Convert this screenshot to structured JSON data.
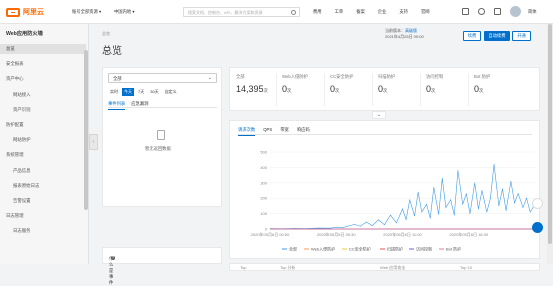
{
  "topbar": {
    "logo_text": "阿里云",
    "account_select": "账号全部资源",
    "region_select": "中国内地",
    "search_placeholder": "搜索文档、控制台、API、解决方案和资源",
    "nav": [
      "费用",
      "工单",
      "备案",
      "企业",
      "支持",
      "官网"
    ],
    "lang": "简体"
  },
  "sidebar": {
    "title": "Web应用防火墙",
    "items": [
      {
        "label": "总览",
        "level": 0,
        "active": true
      },
      {
        "label": "安全报表",
        "level": 0,
        "active": false
      },
      {
        "label": "资产中心",
        "level": 0,
        "active": false
      },
      {
        "label": "网站接入",
        "level": 1,
        "active": false
      },
      {
        "label": "资产识别",
        "level": 1,
        "active": false
      },
      {
        "label": "防护配置",
        "level": 0,
        "active": false
      },
      {
        "label": "网站防护",
        "level": 1,
        "active": false
      },
      {
        "label": "系统管理",
        "level": 0,
        "active": false
      },
      {
        "label": "产品信息",
        "level": 1,
        "active": false
      },
      {
        "label": "报表原始日志",
        "level": 1,
        "active": false
      },
      {
        "label": "告警设置",
        "level": 1,
        "active": false
      },
      {
        "label": "日志管理",
        "level": 0,
        "active": false
      },
      {
        "label": "日志服务",
        "level": 1,
        "active": false
      }
    ],
    "collapse_glyph": "‹"
  },
  "main": {
    "breadcrumb": "总览",
    "title": "总览",
    "update": {
      "prefix": "当前版本：",
      "version": "高级版",
      "date": "2021年4月25日 00:00"
    },
    "buttons": {
      "upgrade": "续费",
      "renew": "自动续费",
      "activate": "开通"
    }
  },
  "left_panel": {
    "select_value": "全部",
    "ranges": [
      {
        "label": "实时",
        "on": false
      },
      {
        "label": "今天",
        "on": true
      },
      {
        "label": "7天",
        "on": false
      },
      {
        "label": "30天",
        "on": false
      },
      {
        "label": "自定义",
        "on": false
      }
    ],
    "tabs": [
      {
        "label": "事件列表",
        "on": true
      },
      {
        "label": "应急漏洞",
        "on": false
      }
    ],
    "empty_text": "暂无返回数据",
    "bottom_label": "什么是事件"
  },
  "stats": [
    {
      "label": "全部",
      "value": "14,395",
      "unit": "次"
    },
    {
      "label": "Web入侵防护",
      "value": "0",
      "unit": "次"
    },
    {
      "label": "CC安全防护",
      "value": "0",
      "unit": "次"
    },
    {
      "label": "扫描防护",
      "value": "0",
      "unit": "次"
    },
    {
      "label": "访问控制",
      "value": "0",
      "unit": "次"
    },
    {
      "label": "Bot 防护",
      "value": "0",
      "unit": "次"
    }
  ],
  "collapse_toggle": "⌄",
  "chart_tabs": [
    {
      "label": "请求次数",
      "on": true
    },
    {
      "label": "QPS",
      "on": false
    },
    {
      "label": "带宽",
      "on": false
    },
    {
      "label": "响应码",
      "on": false
    }
  ],
  "chart_data": {
    "type": "line",
    "ylim": [
      0,
      500
    ],
    "yticks": [
      0,
      100,
      200,
      300,
      400,
      500
    ],
    "xticks": [
      "2020年05月6日 00:00",
      "2020年05月6日 05:30",
      "2020年05月6日 11:00",
      "2020年05月6日 16:30"
    ],
    "x_range_hours": [
      0,
      22
    ],
    "colors": {
      "全部": "#3f9ce8",
      "Web入侵防护": "#fe9a4c",
      "CC安全防护": "#f2c94c",
      "扫描防护": "#e8504f",
      "访问控制": "#7b5cd6",
      "Bot 防护": "#e07ba0"
    },
    "series": [
      {
        "name": "全部",
        "x": [
          0,
          1,
          2,
          3,
          4,
          5,
          5.5,
          6,
          7,
          7.5,
          8,
          8.5,
          9,
          9.5,
          10,
          10.5,
          11,
          11.3,
          11.6,
          12,
          12.3,
          12.6,
          13,
          13.3,
          13.6,
          14,
          14.3,
          14.6,
          15,
          15.3,
          15.6,
          16,
          16.3,
          16.6,
          17,
          17.3,
          17.6,
          18,
          18.3,
          18.6,
          19,
          19.3,
          19.6,
          20,
          20.3,
          20.6,
          21,
          21.3,
          21.6,
          22
        ],
        "y": [
          3,
          2,
          4,
          3,
          6,
          5,
          12,
          8,
          30,
          18,
          45,
          22,
          60,
          28,
          90,
          40,
          130,
          60,
          190,
          85,
          240,
          110,
          160,
          70,
          270,
          95,
          330,
          140,
          190,
          90,
          380,
          160,
          230,
          100,
          300,
          130,
          250,
          110,
          200,
          420,
          150,
          260,
          120,
          310,
          170,
          230,
          140,
          200,
          110,
          160
        ]
      },
      {
        "name": "Web入侵防护",
        "x": [
          0,
          22
        ],
        "y": [
          0,
          0
        ]
      },
      {
        "name": "CC安全防护",
        "x": [
          0,
          22
        ],
        "y": [
          0,
          0
        ]
      },
      {
        "name": "扫描防护",
        "x": [
          0,
          22
        ],
        "y": [
          0,
          0
        ]
      },
      {
        "name": "访问控制",
        "x": [
          0,
          22
        ],
        "y": [
          0,
          0
        ]
      },
      {
        "name": "Bot 防护",
        "x": [
          0,
          22
        ],
        "y": [
          0,
          0
        ]
      }
    ]
  },
  "bottom_tabs": [
    "Top",
    "Top 分析",
    "Web 应用攻击",
    "Top 10"
  ]
}
